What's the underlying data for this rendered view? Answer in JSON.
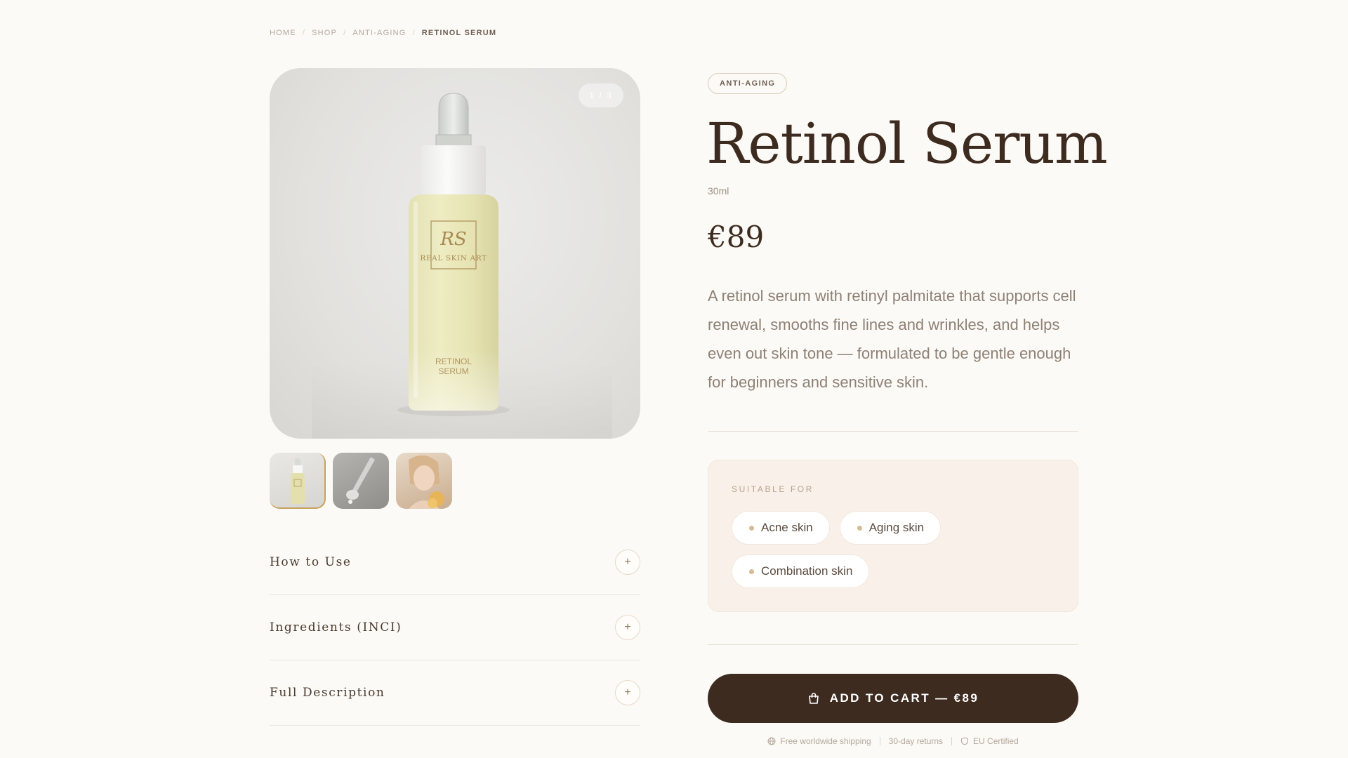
{
  "breadcrumb": {
    "items": [
      "HOME",
      "SHOP",
      "ANTI-AGING"
    ],
    "current": "RETINOL SERUM",
    "separator": "/"
  },
  "gallery": {
    "counter": "1 / 3",
    "bottle_brand": "REAL SKIN ART",
    "bottle_monogram": "RS",
    "bottle_label": [
      "RETINOL",
      "SERUM"
    ]
  },
  "accordion": [
    {
      "title": "How to Use",
      "toggle": "+"
    },
    {
      "title": "Ingredients (INCI)",
      "toggle": "+"
    },
    {
      "title": "Full Description",
      "toggle": "+"
    }
  ],
  "product": {
    "category": "ANTI-AGING",
    "title": "Retinol Serum",
    "size": "30ml",
    "price": "€89",
    "description": "A retinol serum with retinyl palmitate that supports cell renewal, smooths fine lines and wrinkles, and helps even out skin tone — formulated to be gentle enough for beginners and sensitive skin."
  },
  "suitable_for": {
    "label": "SUITABLE FOR",
    "chips": [
      "Acne skin",
      "Aging skin",
      "Combination skin"
    ]
  },
  "cart": {
    "label": "ADD TO CART — €89"
  },
  "trust": {
    "shipping": "Free worldwide shipping",
    "returns": "30-day returns",
    "certified": "EU Certified"
  },
  "colors": {
    "background": "#fcfaf6",
    "primary": "#3d2b20",
    "accent_gold": "#c9a25e",
    "panel": "#f9f1e9"
  },
  "icons": [
    "shopping-bag-icon",
    "globe-icon",
    "shield-icon",
    "plus-icon"
  ]
}
